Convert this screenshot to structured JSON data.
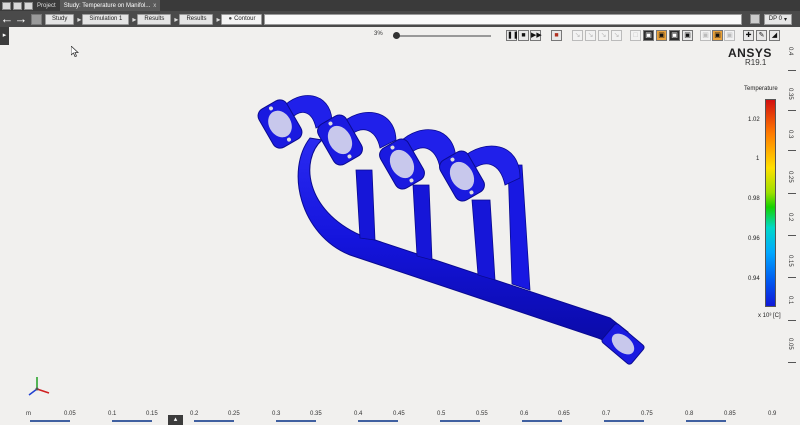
{
  "tabbar": {
    "project_tab": "Project",
    "study_tab": "Study: Temperature on Manifol...",
    "close_glyph": "x"
  },
  "navbar": {
    "back_icon": "arrow-left-icon",
    "forward_icon": "arrow-right-icon",
    "breadcrumbs": [
      "Study",
      "Simulation 1",
      "Results",
      "Results",
      "Contour"
    ],
    "dp_label": "DP 0"
  },
  "toolbar": {
    "progress": "3%",
    "slider_fraction": 0.03
  },
  "brand": {
    "name": "ANSYS",
    "version": "R19.1"
  },
  "legend": {
    "title": "Temperature",
    "ticks": [
      "1.02",
      "1",
      "0.98",
      "0.96",
      "0.94"
    ],
    "unit": "x 10³ [C]",
    "colors": [
      "#d21010",
      "#ff7a00",
      "#ffe000",
      "#14d200",
      "#00d8c8",
      "#00a8ff",
      "#1018d8"
    ]
  },
  "right_scale": {
    "labels": [
      "0.4",
      "0.35",
      "0.3",
      "0.25",
      "0.2",
      "0.15",
      "0.1",
      "0.05"
    ]
  },
  "bottom_scale": {
    "unit": "m",
    "labels": [
      "0.05",
      "0.1",
      "0.15",
      "0.2",
      "0.25",
      "0.3",
      "0.35",
      "0.4",
      "0.45",
      "0.5",
      "0.55",
      "0.6",
      "0.65",
      "0.7",
      "0.75",
      "0.8",
      "0.85",
      "0.9"
    ]
  },
  "model": {
    "color": "#1a1ae0",
    "flange_color": "#c8c8ec"
  }
}
